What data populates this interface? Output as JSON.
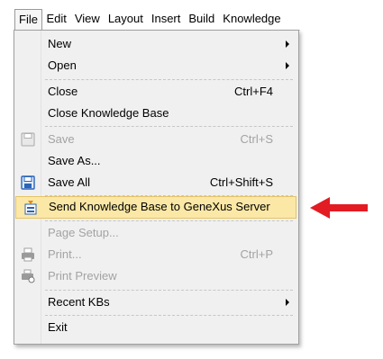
{
  "menubar": {
    "items": [
      "File",
      "Edit",
      "View",
      "Layout",
      "Insert",
      "Build",
      "Knowledge"
    ]
  },
  "file_menu": {
    "items": [
      {
        "label": "New",
        "submenu": true
      },
      {
        "label": "Open",
        "submenu": true
      },
      {
        "label": "Close",
        "shortcut": "Ctrl+F4"
      },
      {
        "label": "Close Knowledge Base"
      },
      {
        "label": "Save",
        "shortcut": "Ctrl+S",
        "disabled": true,
        "icon": "save-icon"
      },
      {
        "label": "Save As..."
      },
      {
        "label": "Save All",
        "shortcut": "Ctrl+Shift+S",
        "icon": "save-all-icon"
      },
      {
        "label": "Send Knowledge Base to GeneXus Server",
        "highlighted": true,
        "icon": "genexus-server-icon"
      },
      {
        "label": "Page Setup...",
        "disabled": true
      },
      {
        "label": "Print...",
        "shortcut": "Ctrl+P",
        "disabled": true,
        "icon": "printer-icon"
      },
      {
        "label": "Print Preview",
        "disabled": true,
        "icon": "print-preview-icon"
      },
      {
        "label": "Recent KBs",
        "submenu": true
      },
      {
        "label": "Exit"
      }
    ]
  },
  "annotation": {
    "icon": "red-arrow-icon",
    "color": "#e31b23"
  },
  "colors": {
    "highlight_bg": "#fbe8a6",
    "highlight_border": "#e5c365",
    "disabled_text": "#a3a3a3"
  }
}
